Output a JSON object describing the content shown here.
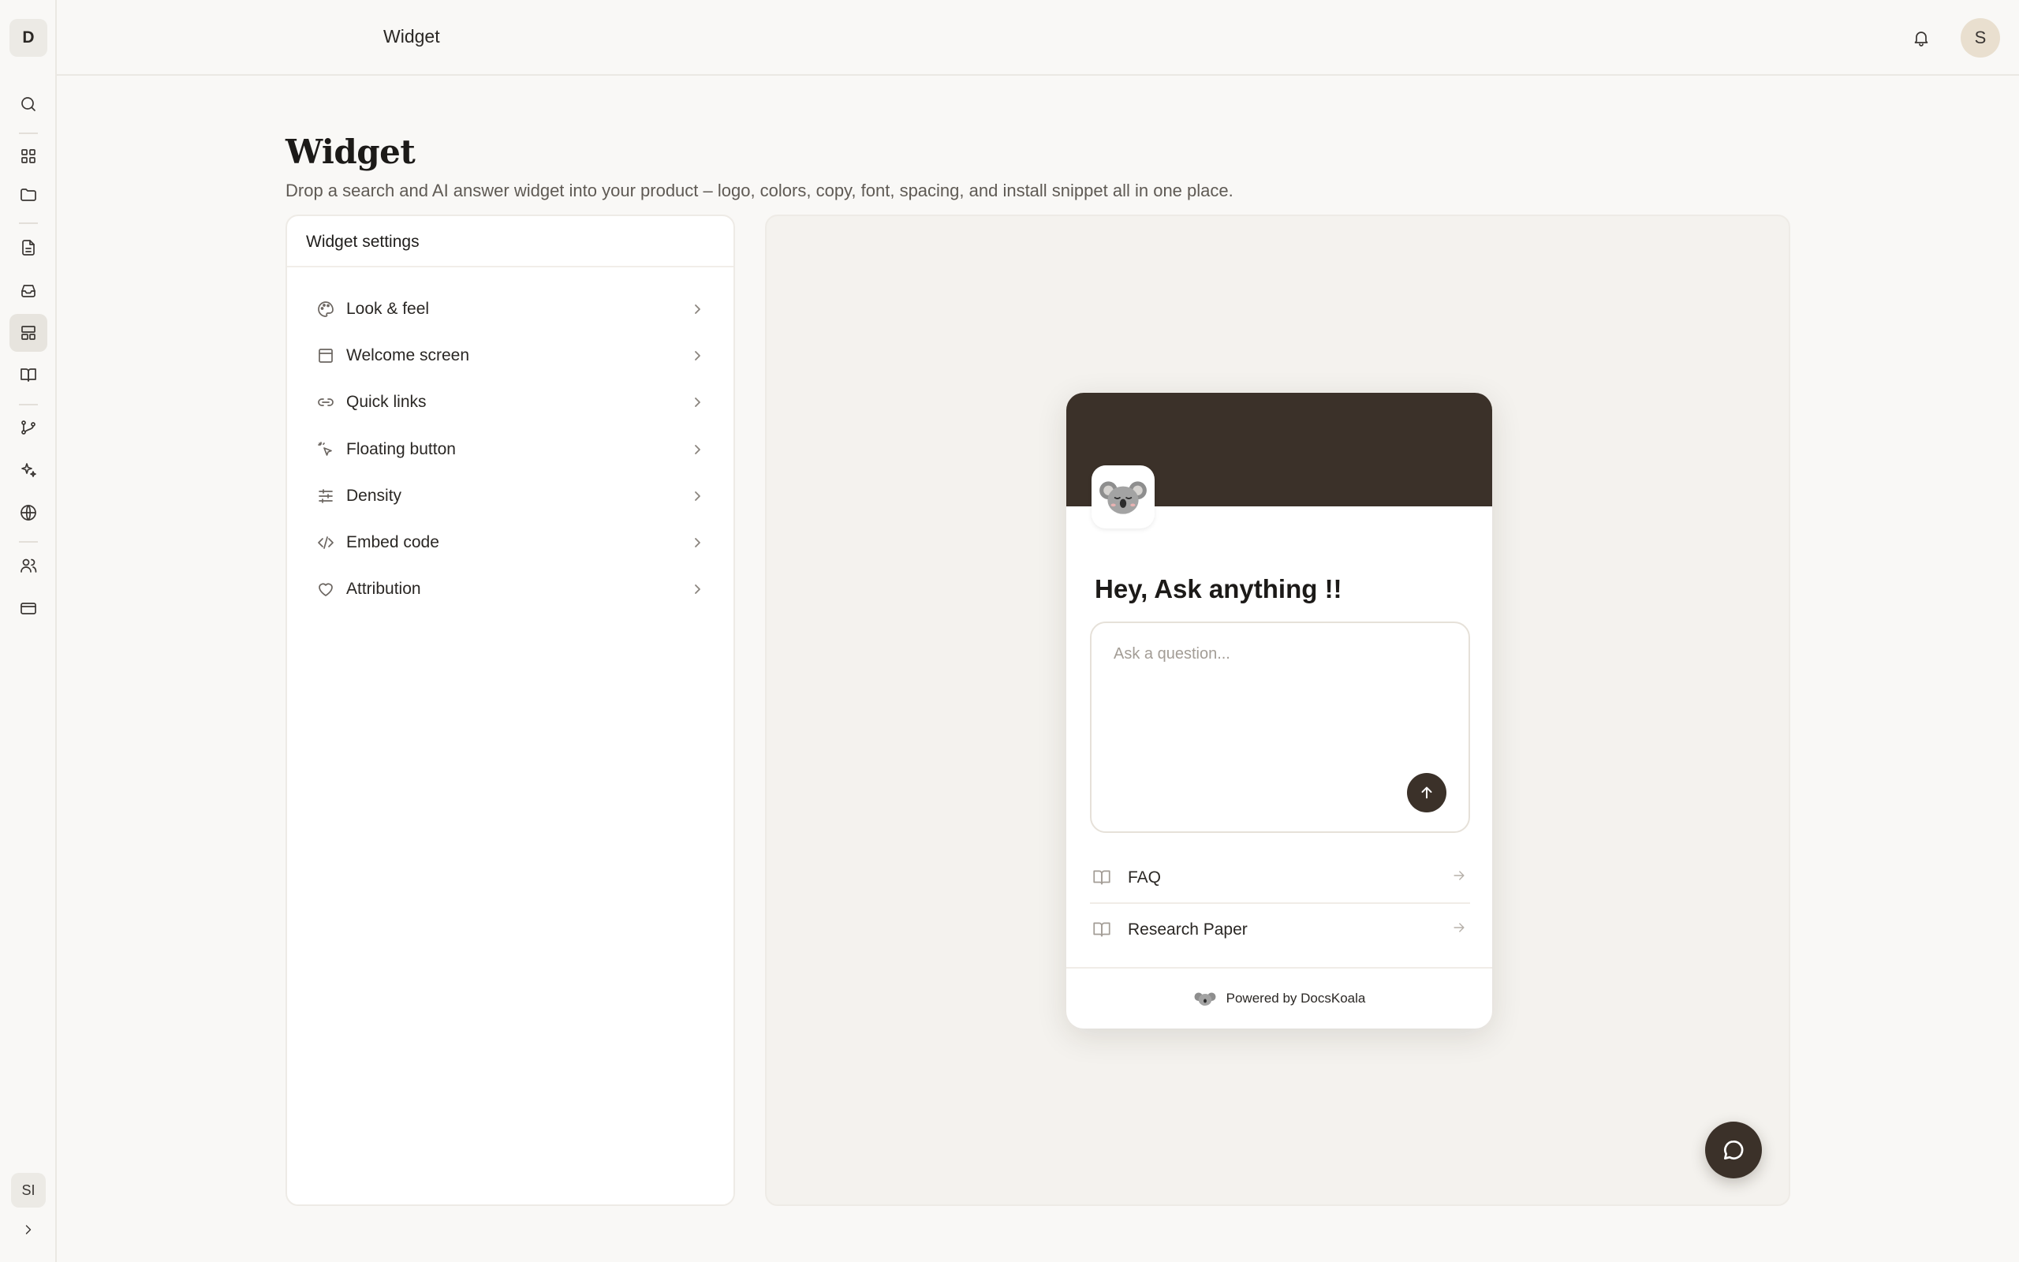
{
  "app": {
    "logo_letter": "D",
    "user_initials": "SI",
    "avatar_initial": "S"
  },
  "header": {
    "title": "Widget"
  },
  "nav": {
    "items": [
      {
        "icon": "search-icon"
      },
      {
        "icon": "dashboard-icon"
      },
      {
        "icon": "folder-icon"
      },
      {
        "icon": "document-icon"
      },
      {
        "icon": "inbox-icon"
      },
      {
        "icon": "widget-layout-icon",
        "active": true
      },
      {
        "icon": "book-icon"
      },
      {
        "icon": "git-branch-icon"
      },
      {
        "icon": "sparkles-icon"
      },
      {
        "icon": "globe-icon"
      },
      {
        "icon": "users-icon"
      },
      {
        "icon": "credit-card-icon"
      }
    ]
  },
  "page": {
    "title": "Widget",
    "subtitle": "Drop a search and AI answer widget into your product – logo, colors, copy, font, spacing, and install snippet all in one place."
  },
  "settings": {
    "header": "Widget settings",
    "items": [
      {
        "label": "Look & feel",
        "icon": "palette-icon"
      },
      {
        "label": "Welcome screen",
        "icon": "window-icon"
      },
      {
        "label": "Quick links",
        "icon": "link-icon"
      },
      {
        "label": "Floating button",
        "icon": "pointer-click-icon"
      },
      {
        "label": "Density",
        "icon": "sliders-icon"
      },
      {
        "label": "Embed code",
        "icon": "code-icon"
      },
      {
        "label": "Attribution",
        "icon": "heart-icon"
      }
    ]
  },
  "widget": {
    "heading": "Hey, Ask anything !!",
    "input_placeholder": "Ask a question...",
    "quick_links": [
      {
        "label": "FAQ",
        "icon": "book-open-icon"
      },
      {
        "label": "Research Paper",
        "icon": "book-open-icon"
      }
    ],
    "footer": "Powered by DocsKoala",
    "header_color": "#3b3129"
  },
  "colors": {
    "accent": "#3b3129",
    "background": "#f9f8f6",
    "preview_bg": "#f4f2ee"
  }
}
